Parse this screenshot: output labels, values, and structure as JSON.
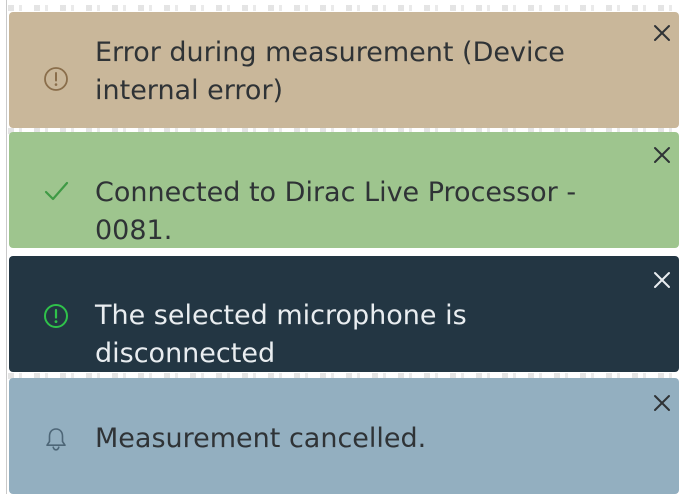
{
  "toasts": [
    {
      "type": "error",
      "icon": "alert-circle-icon",
      "message": "Error during measurement (Device internal error)",
      "background": "#c9b79a",
      "icon_color": "#8a6e4b"
    },
    {
      "type": "success",
      "icon": "checkmark-icon",
      "message": "Connected to Dirac Live Processor - 0081.",
      "background": "#9ec58e",
      "icon_color": "#3f9a45"
    },
    {
      "type": "warning",
      "icon": "alert-circle-icon",
      "message": "The selected microphone is disconnected",
      "background": "#233643",
      "icon_color": "#2fc24a"
    },
    {
      "type": "info",
      "icon": "bell-icon",
      "message": "Measurement cancelled.",
      "background": "#93afc0",
      "icon_color": "#4d6677"
    }
  ]
}
